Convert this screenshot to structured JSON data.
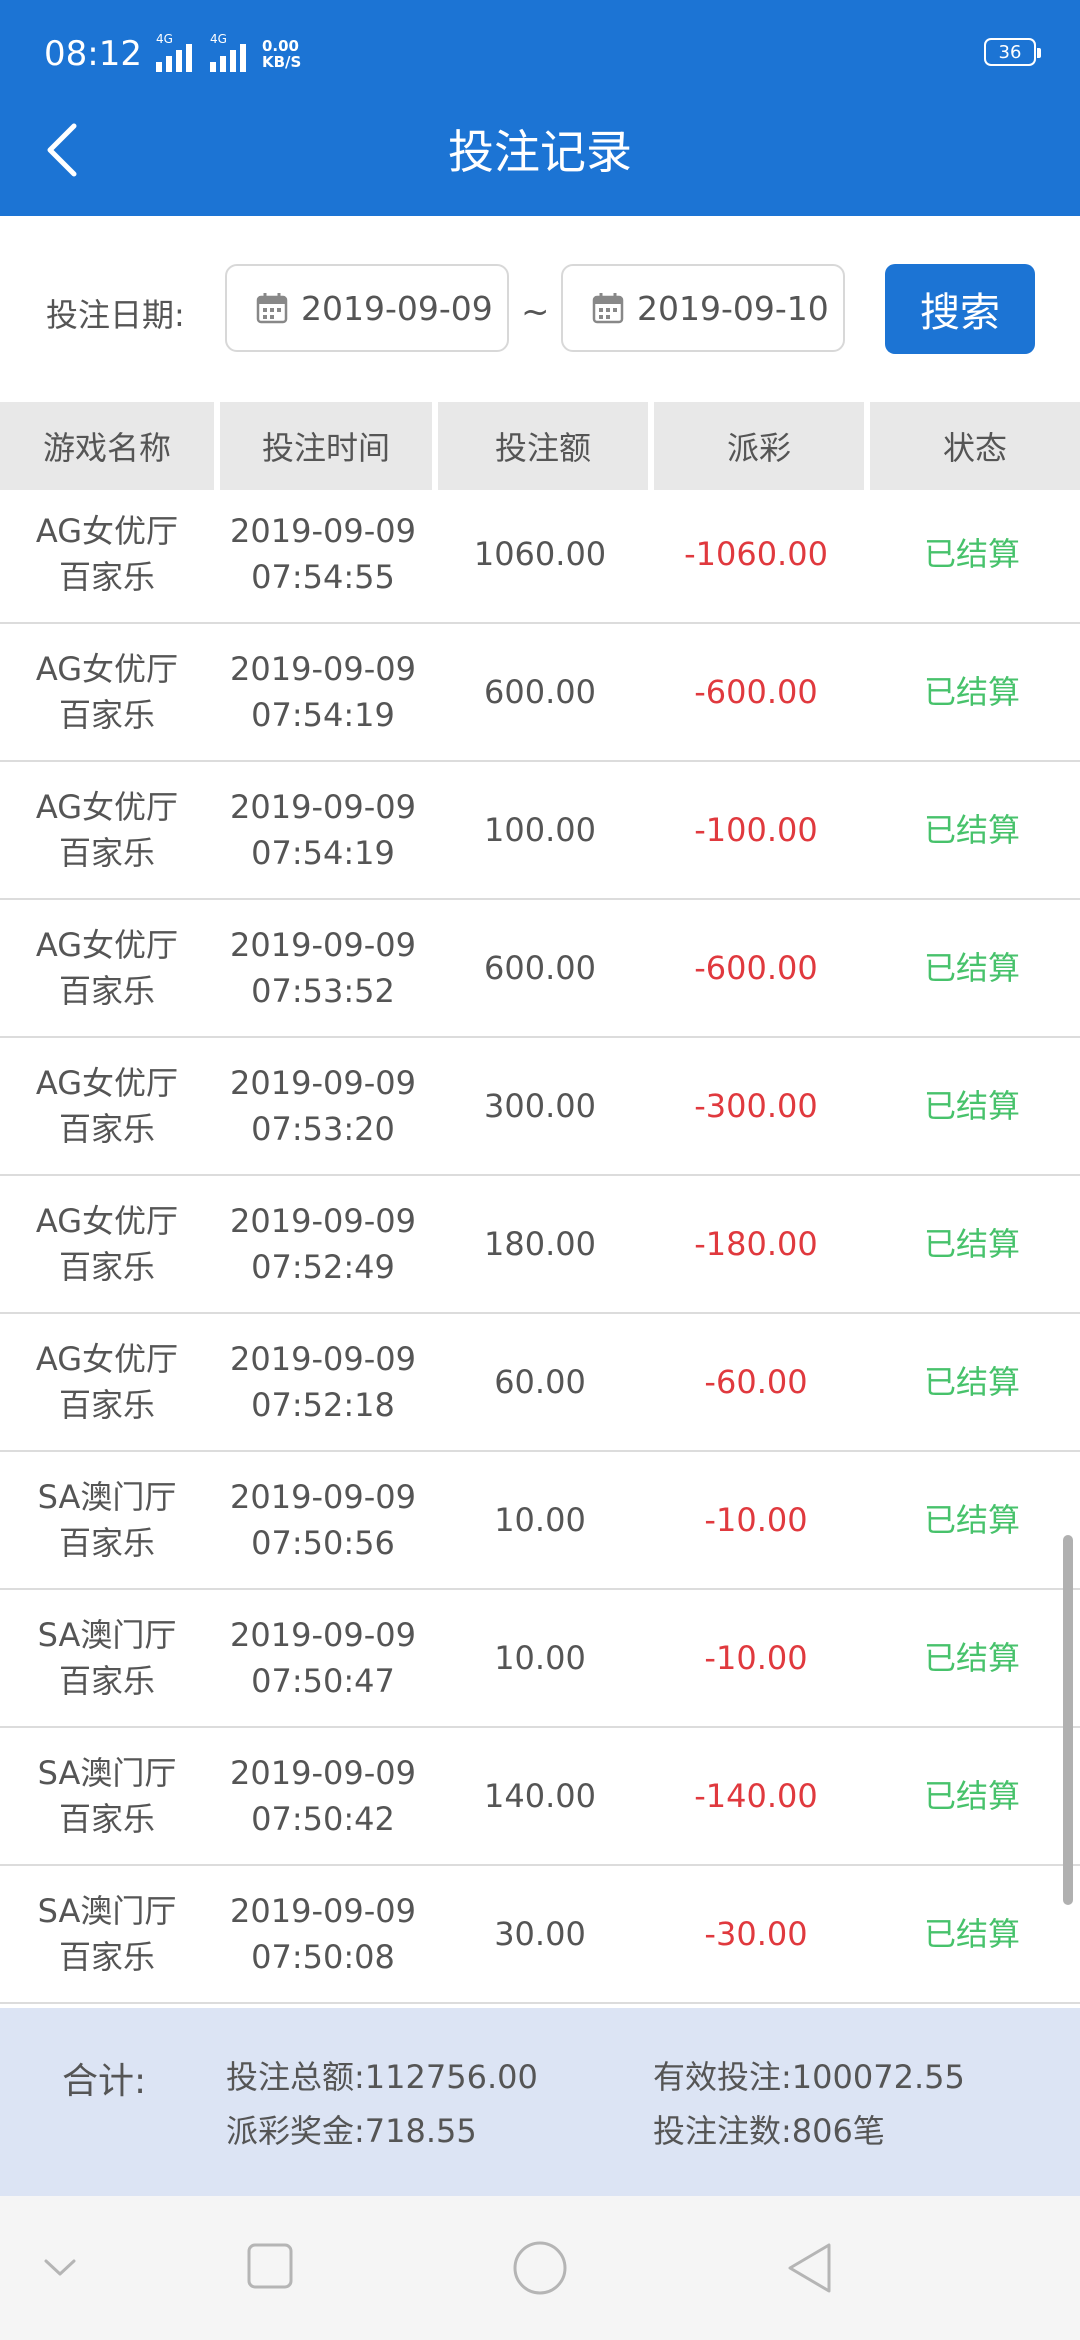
{
  "status": {
    "time": "08:12",
    "net1": "4G",
    "net2": "4G",
    "speed_top": "0.00",
    "speed_bottom": "KB/S",
    "battery": "36"
  },
  "header": {
    "title": "投注记录"
  },
  "filter": {
    "label": "投注日期:",
    "start": "2019-09-09",
    "separator": "~",
    "end": "2019-09-10",
    "search_label": "搜索"
  },
  "table": {
    "headers": [
      "游戏名称",
      "投注时间",
      "投注额",
      "派彩",
      "状态"
    ],
    "rows": [
      {
        "game1": "AG女优厅",
        "game2": "百家乐",
        "date": "2019-09-09",
        "time": "07:54:55",
        "amount": "1060.00",
        "payout": "-1060.00",
        "status": "已结算"
      },
      {
        "game1": "AG女优厅",
        "game2": "百家乐",
        "date": "2019-09-09",
        "time": "07:54:19",
        "amount": "600.00",
        "payout": "-600.00",
        "status": "已结算"
      },
      {
        "game1": "AG女优厅",
        "game2": "百家乐",
        "date": "2019-09-09",
        "time": "07:54:19",
        "amount": "100.00",
        "payout": "-100.00",
        "status": "已结算"
      },
      {
        "game1": "AG女优厅",
        "game2": "百家乐",
        "date": "2019-09-09",
        "time": "07:53:52",
        "amount": "600.00",
        "payout": "-600.00",
        "status": "已结算"
      },
      {
        "game1": "AG女优厅",
        "game2": "百家乐",
        "date": "2019-09-09",
        "time": "07:53:20",
        "amount": "300.00",
        "payout": "-300.00",
        "status": "已结算"
      },
      {
        "game1": "AG女优厅",
        "game2": "百家乐",
        "date": "2019-09-09",
        "time": "07:52:49",
        "amount": "180.00",
        "payout": "-180.00",
        "status": "已结算"
      },
      {
        "game1": "AG女优厅",
        "game2": "百家乐",
        "date": "2019-09-09",
        "time": "07:52:18",
        "amount": "60.00",
        "payout": "-60.00",
        "status": "已结算"
      },
      {
        "game1": "SA澳门厅",
        "game2": "百家乐",
        "date": "2019-09-09",
        "time": "07:50:56",
        "amount": "10.00",
        "payout": "-10.00",
        "status": "已结算"
      },
      {
        "game1": "SA澳门厅",
        "game2": "百家乐",
        "date": "2019-09-09",
        "time": "07:50:47",
        "amount": "10.00",
        "payout": "-10.00",
        "status": "已结算"
      },
      {
        "game1": "SA澳门厅",
        "game2": "百家乐",
        "date": "2019-09-09",
        "time": "07:50:42",
        "amount": "140.00",
        "payout": "-140.00",
        "status": "已结算"
      },
      {
        "game1": "SA澳门厅",
        "game2": "百家乐",
        "date": "2019-09-09",
        "time": "07:50:08",
        "amount": "30.00",
        "payout": "-30.00",
        "status": "已结算"
      }
    ]
  },
  "summary": {
    "label": "合计:",
    "total_bet": "投注总额:112756.00",
    "valid_bet": "有效投注:100072.55",
    "payout": "派彩奖金:718.55",
    "count": "投注注数:806笔"
  },
  "colors": {
    "primary": "#1c74d4",
    "negative": "#e0393e",
    "settled": "#47c26b",
    "summary_bg": "#dce4f4"
  },
  "icons": [
    "back-arrow-icon",
    "calendar-icon",
    "nav-collapse-icon",
    "nav-recent-icon",
    "nav-home-icon",
    "nav-back-icon"
  ]
}
